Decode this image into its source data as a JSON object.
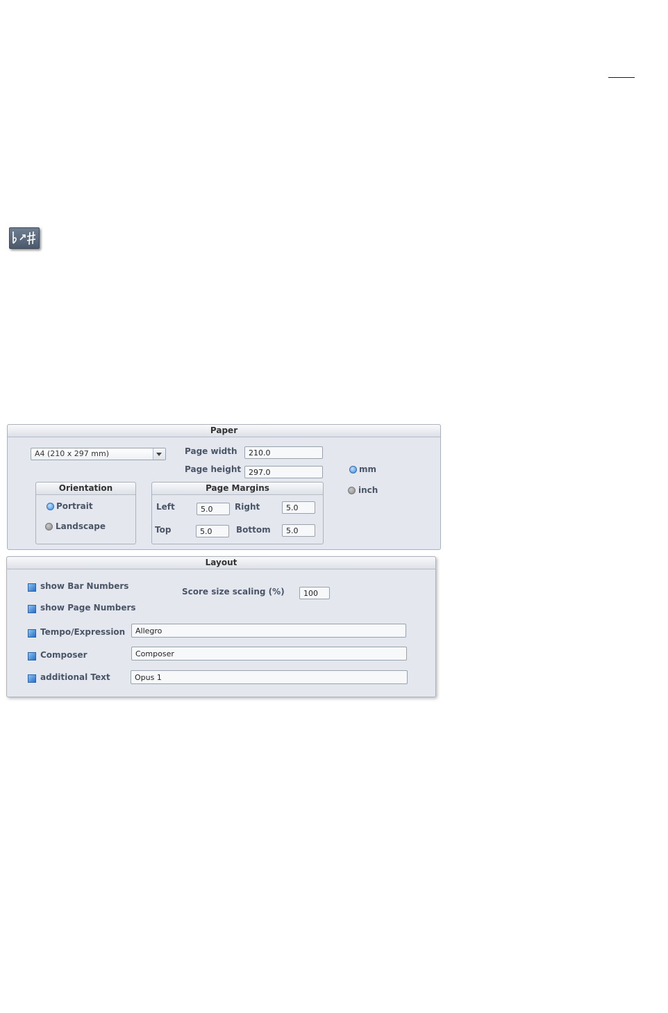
{
  "icons": {
    "toolbar_icon": "accidental-sharp-flat-icon"
  },
  "paper": {
    "title": "Paper",
    "paper_size": "A4 (210 x 297 mm)",
    "page_width_label": "Page width",
    "page_width": "210.0",
    "page_height_label": "Page height",
    "page_height": "297.0",
    "unit_mm": "mm",
    "unit_inch": "inch",
    "selected_unit": "mm",
    "orientation": {
      "title": "Orientation",
      "portrait": "Portrait",
      "landscape": "Landscape",
      "selected": "Portrait"
    },
    "margins": {
      "title": "Page Margins",
      "left_label": "Left",
      "left": "5.0",
      "right_label": "Right",
      "right": "5.0",
      "top_label": "Top",
      "top": "5.0",
      "bottom_label": "Bottom",
      "bottom": "5.0"
    }
  },
  "layout": {
    "title": "Layout",
    "show_bar_numbers": "show Bar Numbers",
    "show_page_numbers": "show Page Numbers",
    "score_scaling_label": "Score size scaling (%)",
    "score_scaling": "100",
    "tempo_label": "Tempo/Expression",
    "tempo": "Allegro",
    "composer_label": "Composer",
    "composer": "Composer",
    "additional_label": "additional Text",
    "additional": "Opus 1"
  },
  "colors": {
    "panel_bg": "#e4e8ee",
    "accent": "#2a6fc6"
  }
}
